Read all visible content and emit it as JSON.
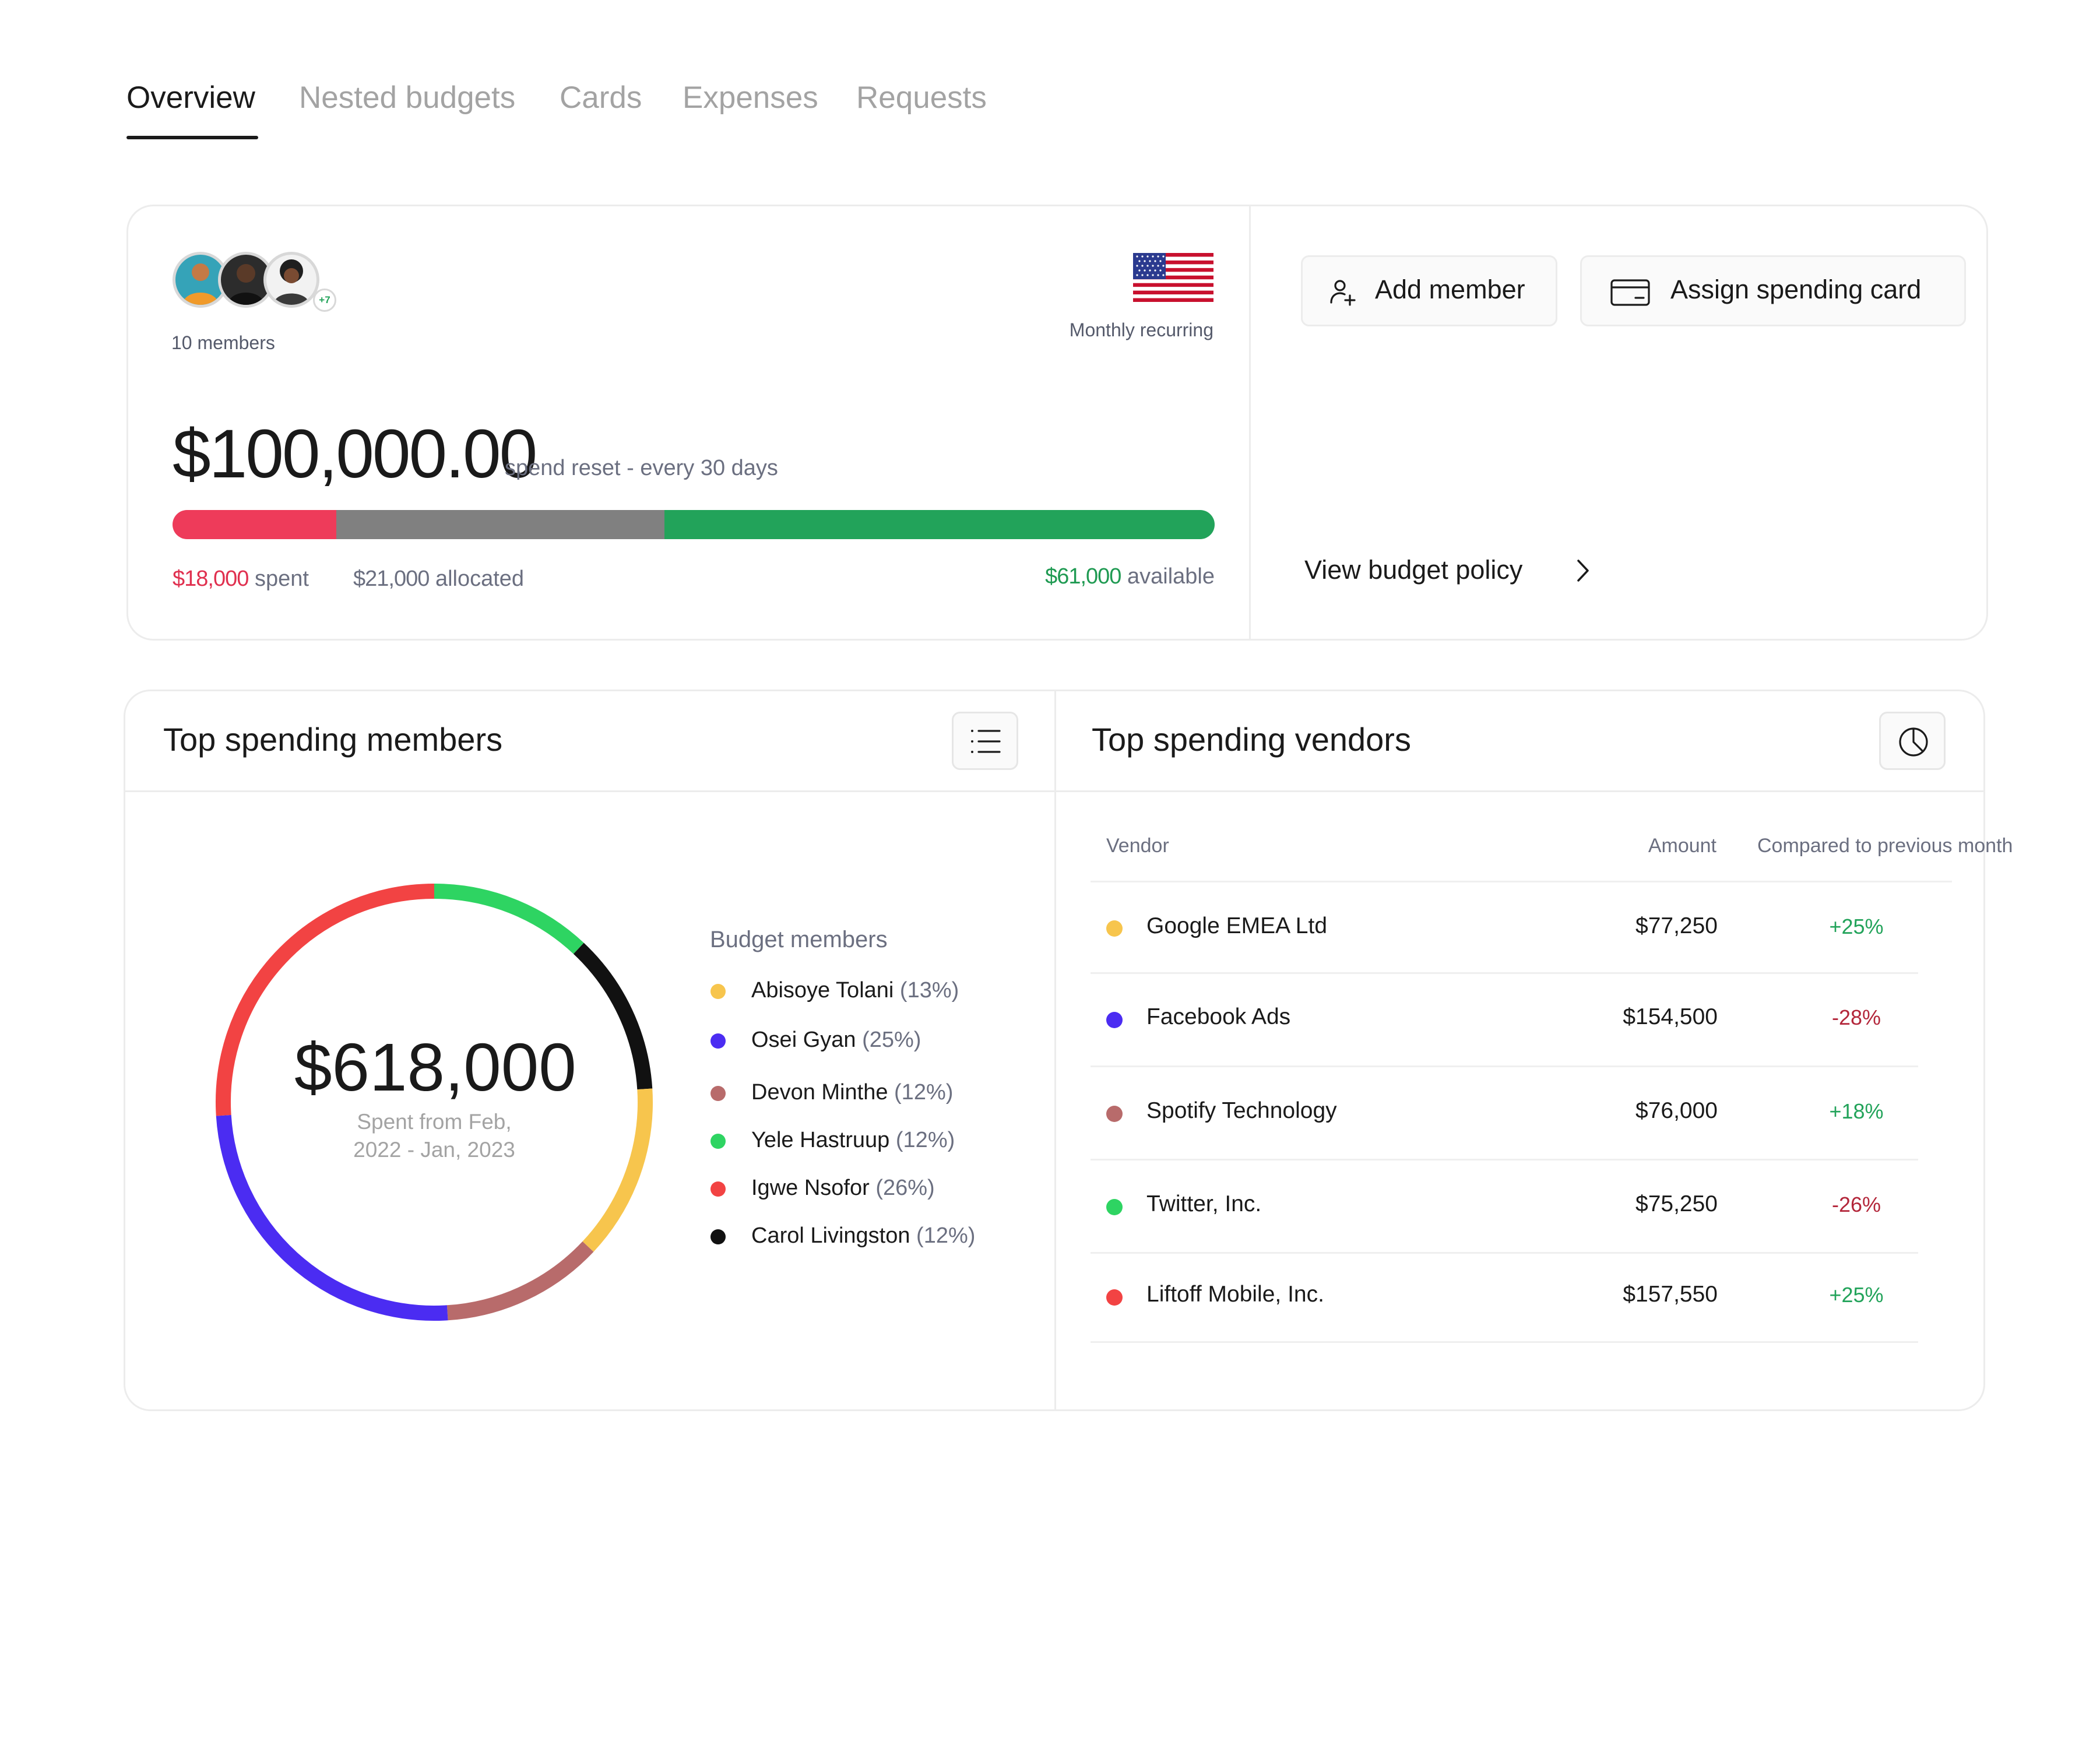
{
  "tabs": [
    {
      "label": "Overview",
      "active": true
    },
    {
      "label": "Nested budgets",
      "active": false
    },
    {
      "label": "Cards",
      "active": false
    },
    {
      "label": "Expenses",
      "active": false
    },
    {
      "label": "Requests",
      "active": false
    }
  ],
  "budget": {
    "members_extra_badge": "+7",
    "members_count_label": "10 members",
    "recurring_label": "Monthly recurring",
    "flag_icon": "us-flag-icon",
    "total_amount": "$100,000.00",
    "reset_label": "spend reset - every 30 days",
    "spent_amount": "$18,000",
    "spent_label": "spent",
    "allocated_amount": "$21,000",
    "allocated_label": "allocated",
    "available_amount": "$61,000",
    "available_label": "available",
    "progress": {
      "spent_fraction": 0.157,
      "allocated_fraction": 0.315,
      "available_fraction": 0.528
    },
    "colors": {
      "spent": "#ee3b5a",
      "allocated": "#808080",
      "available": "#22a35a"
    }
  },
  "actions": {
    "add_member_label": "Add member",
    "assign_card_label": "Assign spending card",
    "view_policy_label": "View budget policy"
  },
  "members_panel": {
    "title": "Top spending members",
    "total": "$618,000",
    "subtitle_line1": "Spent from Feb,",
    "subtitle_line2": "2022 - Jan, 2023",
    "legend_title": "Budget members",
    "members": [
      {
        "name": "Abisoye Tolani",
        "pct": "(13%)",
        "color": "#f7c54d"
      },
      {
        "name": "Osei Gyan",
        "pct": "(25%)",
        "color": "#4b2cf2"
      },
      {
        "name": "Devon Minthe",
        "pct": "(12%)",
        "color": "#b86b6b"
      },
      {
        "name": "Yele Hastruup",
        "pct": "(12%)",
        "color": "#2ed462"
      },
      {
        "name": "Igwe Nsofor",
        "pct": "(26%)",
        "color": "#f24343"
      },
      {
        "name": "Carol Livingston",
        "pct": "(12%)",
        "color": "#111111"
      }
    ]
  },
  "chart_data": {
    "type": "pie",
    "donut": true,
    "labels": [
      "Abisoye Tolani",
      "Osei Gyan",
      "Devon Minthe",
      "Yele Hastruup",
      "Igwe Nsofor",
      "Carol Livingston"
    ],
    "values": [
      13,
      25,
      12,
      12,
      26,
      12
    ],
    "order_clockwise_from_top": [
      "Yele Hastruup",
      "Carol Livingston",
      "Abisoye Tolani",
      "Devon Minthe",
      "Osei Gyan",
      "Igwe Nsofor"
    ],
    "colors": [
      "#f7c54d",
      "#4b2cf2",
      "#b86b6b",
      "#2ed462",
      "#f24343",
      "#111111"
    ]
  },
  "vendors_panel": {
    "title": "Top spending vendors",
    "headers": {
      "vendor": "Vendor",
      "amount": "Amount",
      "compare": "Compared to previous month"
    },
    "rows": [
      {
        "name": "Google EMEA Ltd",
        "amount": "$77,250",
        "change": "+25%",
        "color": "#f7c54d",
        "positive": true
      },
      {
        "name": "Facebook Ads",
        "amount": "$154,500",
        "change": "-28%",
        "color": "#4b2cf2",
        "positive": false
      },
      {
        "name": "Spotify Technology",
        "amount": "$76,000",
        "change": "+18%",
        "color": "#b86b6b",
        "positive": true
      },
      {
        "name": "Twitter, Inc.",
        "amount": "$75,250",
        "change": "-26%",
        "color": "#2ed462",
        "positive": false
      },
      {
        "name": "Liftoff Mobile, Inc.",
        "amount": "$157,550",
        "change": "+25%",
        "color": "#f24343",
        "positive": true
      }
    ],
    "positive_color": "#22a35a",
    "negative_color": "#b3263a"
  }
}
